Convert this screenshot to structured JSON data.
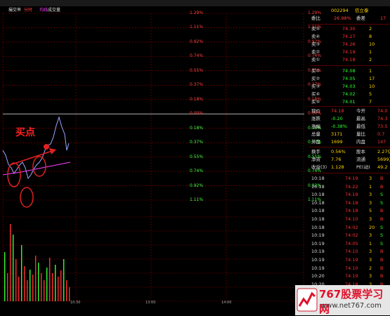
{
  "topbar": {
    "items": [
      "",
      "",
      "",
      "",
      "",
      ""
    ]
  },
  "header": {
    "tab_title": "撮交率",
    "tab_fenshi": "分时",
    "tab_junjia": "均线",
    "tab_chengjiao": "成交量"
  },
  "pct_axis_right": [
    "1.29%",
    "1.11%",
    "0.92%",
    "0.74%",
    "0.55%",
    "0.37%",
    "0.18%",
    "0.00%",
    "0.18%",
    "0.37%",
    "0.55%",
    "0.74%",
    "0.92%",
    "1.11%"
  ],
  "pct_axis_inner": [
    "1.29%",
    "1.11%",
    "0.92%",
    "0.74%",
    "0.55%",
    "0.37%",
    "0.18%",
    "0.00%",
    "0.18%",
    "0.37%",
    "0.55%",
    "0.74%",
    "0.92%",
    "1.11%"
  ],
  "annotation": {
    "text": "买点"
  },
  "time_axis": [
    "10:30",
    "13:00",
    "14:00"
  ],
  "bottom_labels": [
    "",
    "",
    "",
    ""
  ],
  "quote": {
    "code": "002294",
    "name": "信立泰",
    "weibi_label": "委比",
    "weibi_value": "26.98%",
    "weicha_label": "委差",
    "weicha_value": "17",
    "sells": [
      {
        "label": "卖⑤",
        "price": "74.30",
        "vol": "2"
      },
      {
        "label": "卖④",
        "price": "74.27",
        "vol": "8"
      },
      {
        "label": "卖③",
        "price": "74.26",
        "vol": "10"
      },
      {
        "label": "卖②",
        "price": "74.19",
        "vol": "1"
      },
      {
        "label": "卖①",
        "price": "74.18",
        "vol": "2"
      }
    ],
    "buys": [
      {
        "label": "买①",
        "price": "74.08",
        "vol": "1"
      },
      {
        "label": "买②",
        "price": "74.05",
        "vol": "17"
      },
      {
        "label": "买③",
        "price": "74.03",
        "vol": "10"
      },
      {
        "label": "买④",
        "price": "74.02",
        "vol": "5"
      },
      {
        "label": "买⑤",
        "price": "74.01",
        "vol": "7"
      }
    ],
    "stats": [
      {
        "l1": "现价",
        "v1": "74.18",
        "l2": "今开",
        "v2": "74.0"
      },
      {
        "l1": "涨跌",
        "v1": "-0.20",
        "l2": "最高",
        "v2": "74.3"
      },
      {
        "l1": "涨幅",
        "v1": "-0.38%",
        "l2": "最低",
        "v2": "73.5"
      },
      {
        "l1": "总量",
        "v1": "3171",
        "l2": "量比",
        "v2": "0.7"
      },
      {
        "l1": "外盘",
        "v1": "1699",
        "l2": "内盘",
        "v2": "147"
      }
    ],
    "stats2": [
      {
        "l1": "换手",
        "v1": "0.56%",
        "l2": "股本",
        "v2": "2.27亿"
      },
      {
        "l1": "净资",
        "v1": "7.76",
        "l2": "流通",
        "v2": "5699万"
      },
      {
        "l1": "收益(3)",
        "v1": "1.128",
        "l2": "PE(动)",
        "v2": "49.2"
      }
    ],
    "ticks": [
      {
        "t": "10:18",
        "p": "74.19",
        "v": "3",
        "f": "B"
      },
      {
        "t": "10:18",
        "p": "74.22",
        "v": "1",
        "f": "B"
      },
      {
        "t": "10:18",
        "p": "74.19",
        "v": "3",
        "f": "S"
      },
      {
        "t": "10:18",
        "p": "74.18",
        "v": "3",
        "f": "S"
      },
      {
        "t": "10:18",
        "p": "74.18",
        "v": "5",
        "f": "B"
      },
      {
        "t": "10:18",
        "p": "74.10",
        "v": "3",
        "f": "B"
      },
      {
        "t": "10:18",
        "p": "74.02",
        "v": "20",
        "f": "S"
      },
      {
        "t": "10:19",
        "p": "74.02",
        "v": "3",
        "f": "S"
      },
      {
        "t": "10:19",
        "p": "74.05",
        "v": "1",
        "f": "S"
      },
      {
        "t": "10:19",
        "p": "74.10",
        "v": "3",
        "f": "B"
      },
      {
        "t": "10:19",
        "p": "74.19",
        "v": "3",
        "f": "B"
      },
      {
        "t": "10:19",
        "p": "74.10",
        "v": "2",
        "f": "B"
      },
      {
        "t": "10:20",
        "p": "74.19",
        "v": "3",
        "f": "B"
      },
      {
        "t": "10:20",
        "p": "74.18",
        "v": "3",
        "f": "B"
      }
    ]
  },
  "watermark": {
    "brand": "767股票学习网",
    "url": "www.net767.com"
  },
  "colors": {
    "up": "#ff3030",
    "down": "#30ff30",
    "grid": "#8b0000",
    "price": "#9aa7ff",
    "avg": "#ff40ff"
  }
}
